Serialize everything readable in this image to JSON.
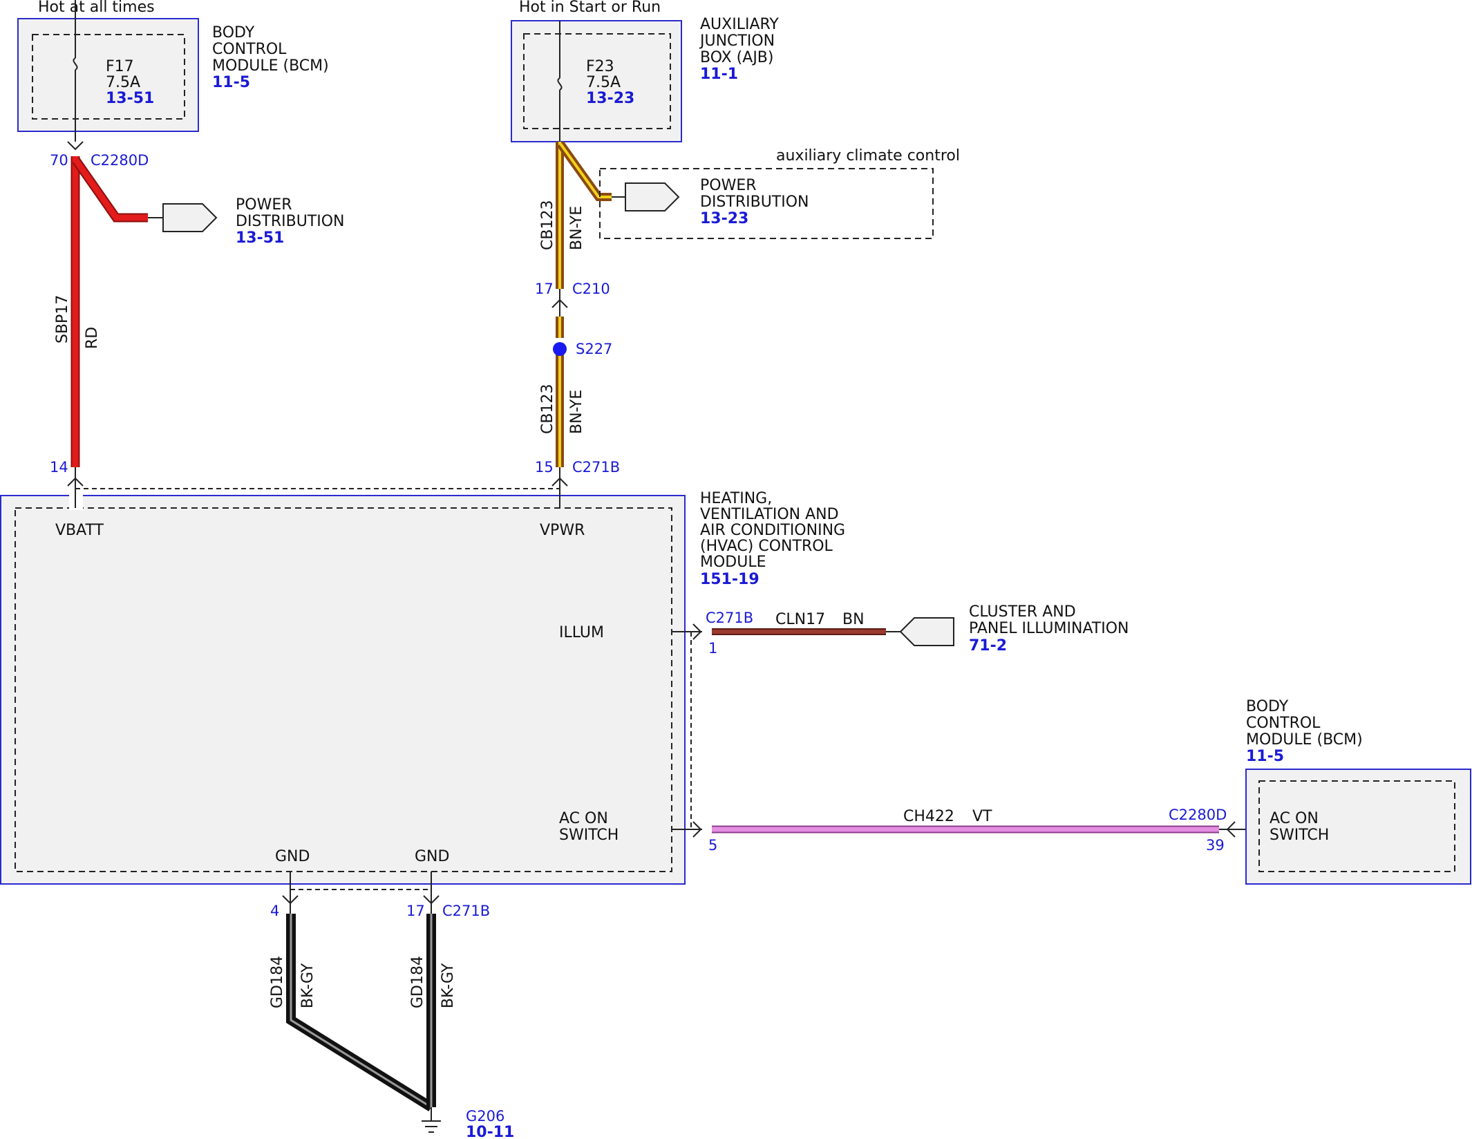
{
  "colors": {
    "wire_rd": "#e21b1b",
    "wire_bn_ye_outer": "#8a4a12",
    "wire_bn_ye_inner": "#f2d21a",
    "wire_bn": "#9b3a2e",
    "wire_vt": "#e58fe3",
    "wire_bk": "#111111",
    "module_frame": "#2a2ad0",
    "module_fill": "#f1f1f1",
    "reference_text": "#1a1ad6",
    "splice": "#1a1af0"
  },
  "top_labels": {
    "hot_always": "Hot at all times",
    "hot_start_run": "Hot in Start or Run"
  },
  "bcm_top": {
    "title_lines": [
      "BODY",
      "CONTROL",
      "MODULE (BCM)"
    ],
    "ref": "11-5",
    "fuse_name": "F17",
    "fuse_rating": "7.5A",
    "fuse_ref": "13-51"
  },
  "ajb": {
    "title_lines": [
      "AUXILIARY",
      "JUNCTION",
      "BOX (AJB)"
    ],
    "ref": "11-1",
    "fuse_name": "F23",
    "fuse_rating": "7.5A",
    "fuse_ref": "13-23"
  },
  "power_dist_1": {
    "lines": [
      "POWER",
      "DISTRIBUTION"
    ],
    "ref": "13-51"
  },
  "aux_climate": {
    "note": "auxiliary climate control",
    "lines": [
      "POWER",
      "DISTRIBUTION"
    ],
    "ref": "13-23"
  },
  "wire_sbp17": {
    "circuit": "SBP17",
    "color": "RD",
    "top_pin": "70",
    "top_connector": "C2280D",
    "bottom_pin": "14"
  },
  "wire_cb123": {
    "circuit": "CB123",
    "color": "BN-YE",
    "pin_c210": "17",
    "connector_c210": "C210",
    "splice": "S227",
    "pin_c271b": "15",
    "connector_c271b": "C271B"
  },
  "hvac": {
    "title_lines": [
      "HEATING,",
      "VENTILATION AND",
      "AIR CONDITIONING",
      "(HVAC) CONTROL",
      "MODULE"
    ],
    "ref": "151-19",
    "vbatt": "VBATT",
    "vpwr": "VPWR",
    "illum": "ILLUM",
    "ac_on_lines": [
      "AC ON",
      "SWITCH"
    ],
    "gnd1": "GND",
    "gnd2": "GND"
  },
  "wire_cln17": {
    "connector": "C271B",
    "pin": "1",
    "circuit": "CLN17",
    "color": "BN"
  },
  "cluster": {
    "lines": [
      "CLUSTER AND",
      "PANEL ILLUMINATION"
    ],
    "ref": "71-2"
  },
  "wire_ch422": {
    "pin_left": "5",
    "circuit": "CH422",
    "color": "VT",
    "connector_right": "C2280D",
    "pin_right": "39"
  },
  "bcm_right": {
    "title_lines": [
      "BODY",
      "CONTROL",
      "MODULE (BCM)"
    ],
    "ref": "11-5",
    "ac_on_lines": [
      "AC ON",
      "SWITCH"
    ]
  },
  "ground": {
    "pin_left": "4",
    "pin_right": "17",
    "connector": "C271B",
    "circuit_left": "GD184",
    "color_left": "BK-GY",
    "circuit_right": "GD184",
    "color_right": "BK-GY",
    "name": "G206",
    "ref": "10-11"
  }
}
